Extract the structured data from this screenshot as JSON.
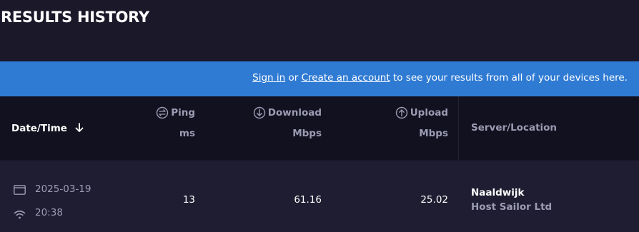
{
  "page": {
    "title": "RESULTS HISTORY"
  },
  "banner": {
    "sign_in": "Sign in",
    "or": " or ",
    "create_account": "Create an account",
    "suffix": " to see your results from all of your devices here."
  },
  "table": {
    "headers": {
      "date_time": "Date/Time",
      "ping": "Ping",
      "ping_unit": "ms",
      "download": "Download",
      "download_unit": "Mbps",
      "upload": "Upload",
      "upload_unit": "Mbps",
      "server": "Server/Location"
    },
    "rows": [
      {
        "date": "2025-03-19",
        "time": "20:38",
        "ping": "13",
        "download": "61.16",
        "upload": "25.02",
        "server_name": "Naaldwijk",
        "server_host": "Host Sailor Ltd"
      }
    ]
  },
  "colors": {
    "background": "#1a1829",
    "banner": "#2f7bd4",
    "header": "#121120",
    "row": "#1e1d31",
    "muted": "#9b9bb3"
  },
  "icons": {
    "sort": "arrow-down-icon",
    "ping": "ping-icon",
    "download": "download-icon",
    "upload": "upload-icon",
    "app": "app-window-icon",
    "connection": "wifi-icon"
  }
}
